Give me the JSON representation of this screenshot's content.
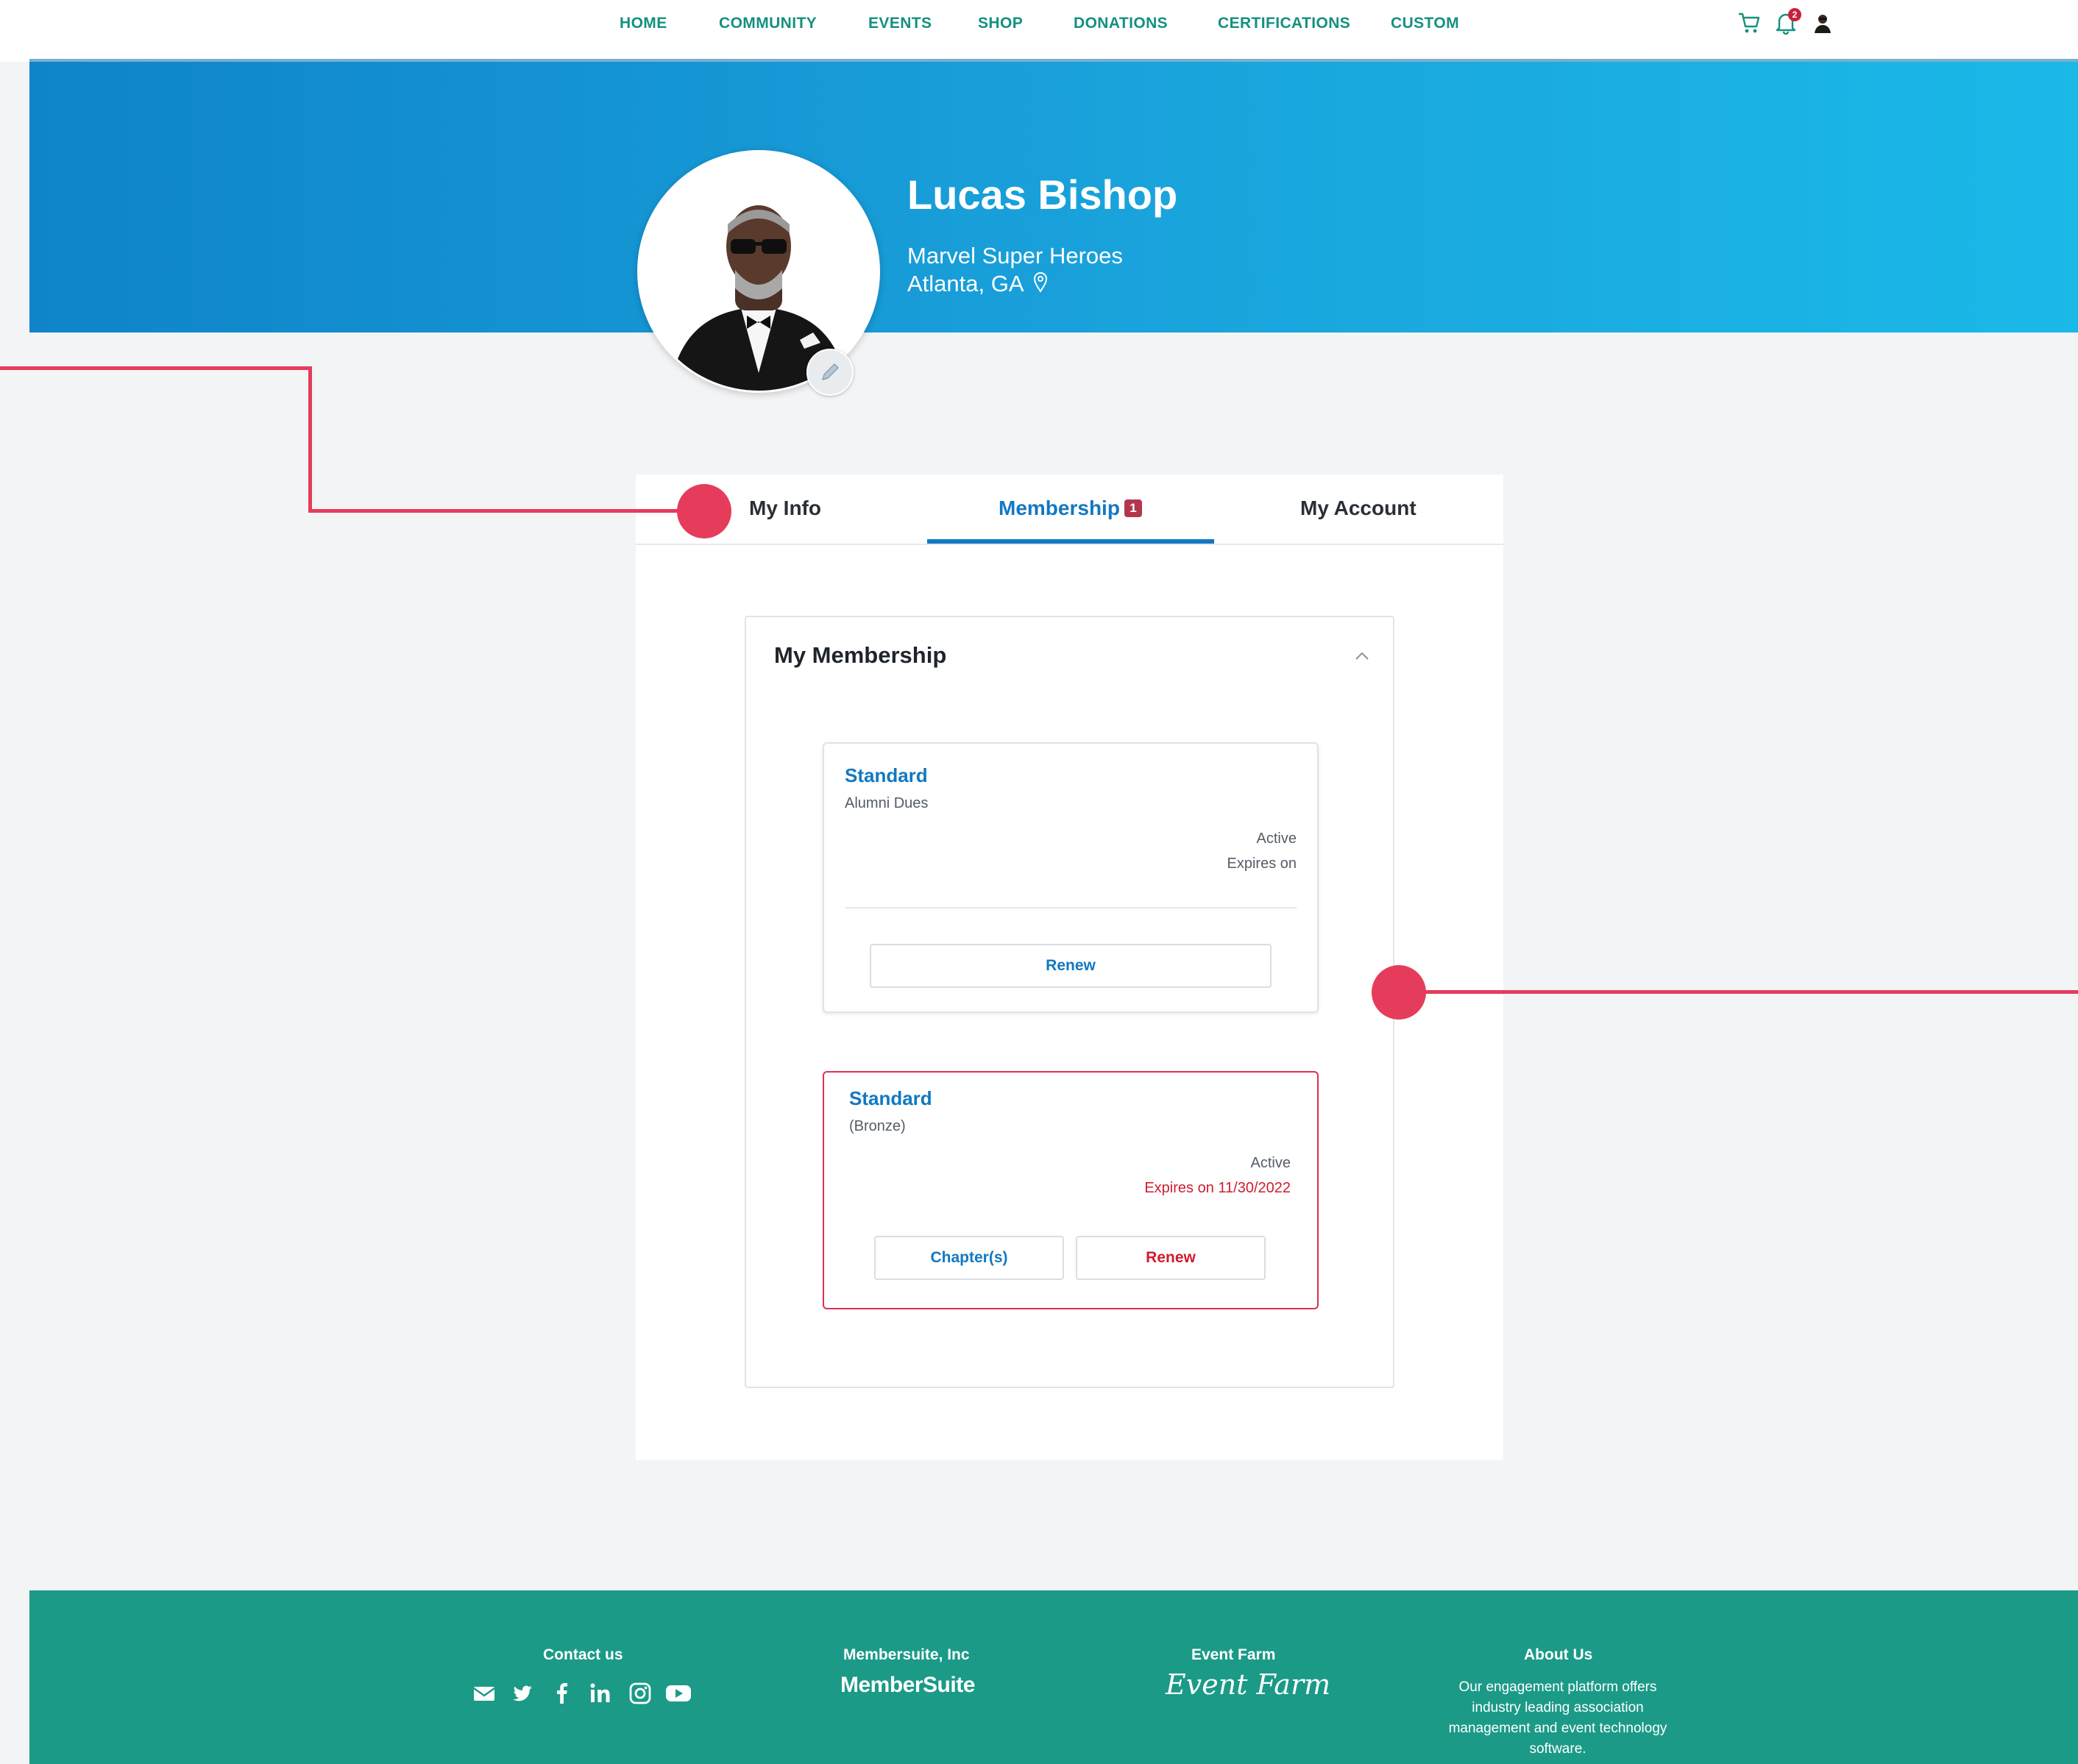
{
  "nav": {
    "links": [
      "HOME",
      "COMMUNITY",
      "EVENTS",
      "SHOP",
      "DONATIONS",
      "CERTIFICATIONS",
      "CUSTOM"
    ],
    "notification_count": "2",
    "icons": [
      "cart-icon",
      "bell-icon",
      "user-avatar"
    ]
  },
  "profile": {
    "name": "Lucas Bishop",
    "organization": "Marvel Super Heroes",
    "location": "Atlanta, GA"
  },
  "tabs": {
    "items": [
      "My Info",
      "Membership",
      "My Account"
    ],
    "active": "Membership",
    "membership_badge": "1"
  },
  "membership": {
    "title": "My Membership",
    "cards": [
      {
        "name": "Standard",
        "subtitle": "Alumni Dues",
        "status": "Active",
        "expires": "Expires on",
        "buttons": [
          "Renew"
        ]
      },
      {
        "name": "Standard",
        "subtitle": "(Bronze)",
        "status": "Active",
        "expires": "Expires on 11/30/2022",
        "buttons": [
          "Chapter(s)",
          "Renew"
        ]
      }
    ]
  },
  "footer": {
    "contact_title": "Contact us",
    "social_icons": [
      "email-icon",
      "twitter-icon",
      "facebook-icon",
      "linkedin-icon",
      "instagram-icon",
      "youtube-icon"
    ],
    "membersuite_title": "Membersuite, Inc",
    "membersuite_logo_text": "MemberSuite",
    "eventfarm_title": "Event Farm",
    "eventfarm_logo_text": "Event Farm",
    "about_title": "About Us",
    "about_text": "Our engagement platform offers industry leading association management and event technology software."
  },
  "colors": {
    "accent_teal": "#14907f",
    "primary_blue": "#1378c2",
    "alert_red": "#d01c2f",
    "annotation_pink": "#e63c5b",
    "footer_teal": "#1b9a87"
  }
}
